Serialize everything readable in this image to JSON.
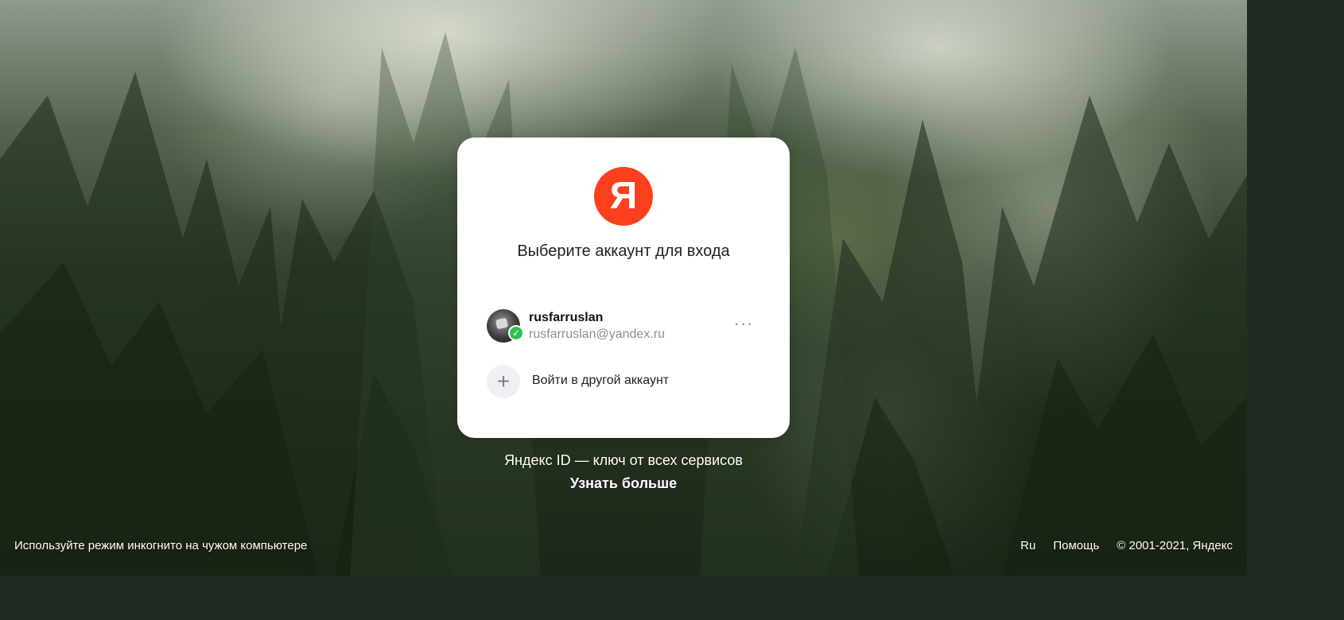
{
  "colors": {
    "brand_red": "#fc3f1d",
    "verified_green": "#2fbf4f",
    "muted_text": "#8a8f98"
  },
  "logo": {
    "glyph": "Я",
    "icon": "yandex-logo-icon"
  },
  "card": {
    "title": "Выберите аккаунт для входа"
  },
  "account": {
    "login": "rusfarruslan",
    "email": "rusfarruslan@yandex.ru",
    "avatar_icon": "user-avatar",
    "status_icon": "check-icon",
    "more_glyph": "···",
    "more_icon": "more-icon"
  },
  "add_account": {
    "plus_glyph": "+",
    "plus_icon": "plus-icon",
    "label": "Войти в другой аккаунт"
  },
  "promo": {
    "text": "Яндекс ID — ключ от всех сервисов",
    "link": "Узнать больше"
  },
  "footer": {
    "incognito_hint": "Используйте режим инкогнито на чужом компьютере",
    "lang": "Ru",
    "help": "Помощь",
    "copyright": "© 2001-2021, Яндекс"
  }
}
